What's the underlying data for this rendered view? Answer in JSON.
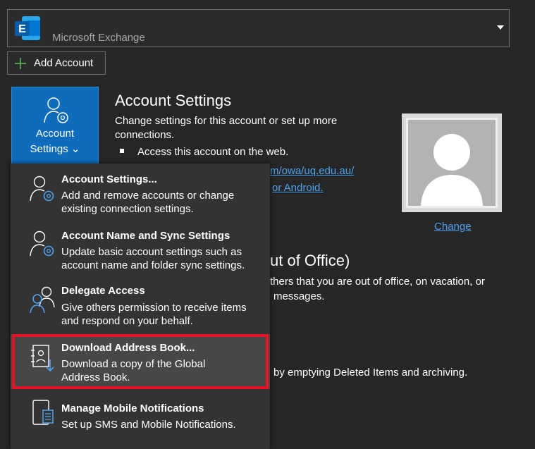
{
  "account_selector": {
    "name": "Microsoft Exchange"
  },
  "add_account": {
    "label": "Add Account"
  },
  "account_settings_button": {
    "line1": "Account",
    "line2": "Settings ⌄"
  },
  "panel": {
    "account_settings": {
      "heading": "Account Settings",
      "desc_line1": "Change settings for this account or set up more",
      "desc_line2": "connections.",
      "bullet1": "Access this account on the web.",
      "link1_fragment": "m/owa/uq.edu.au/",
      "link2_fragment": "or Android."
    },
    "out_of_office": {
      "heading_fragment": "ut of Office)",
      "desc_line1": "thers that you are out of office, on vacation, or",
      "desc_line2": "messages."
    },
    "cleanup": {
      "desc_fragment": "by emptying Deleted Items and archiving."
    },
    "photo": {
      "change_link": "Change"
    }
  },
  "menu": {
    "items": [
      {
        "title": "Account Settings...",
        "desc1": "Add and remove accounts or change",
        "desc2": "existing connection settings.",
        "icon": "person-gear-icon"
      },
      {
        "title": "Account Name and Sync Settings",
        "desc1": "Update basic account settings such as",
        "desc2": "account name and folder sync settings.",
        "icon": "person-gear-icon"
      },
      {
        "title": "Delegate Access",
        "desc1": "Give others permission to receive items",
        "desc2": "and respond on your behalf.",
        "icon": "two-people-icon"
      },
      {
        "title": "Download Address Book...",
        "desc1": "Download a copy of the Global",
        "desc2": "Address Book.",
        "icon": "address-book-download-icon"
      },
      {
        "title": "Manage Mobile Notifications",
        "desc1": "Set up SMS and Mobile Notifications.",
        "desc2": "",
        "icon": "mobile-notifications-icon"
      }
    ]
  },
  "colors": {
    "accent": "#0f6cbd",
    "highlight": "#e81123",
    "link": "#4ea1ef"
  }
}
